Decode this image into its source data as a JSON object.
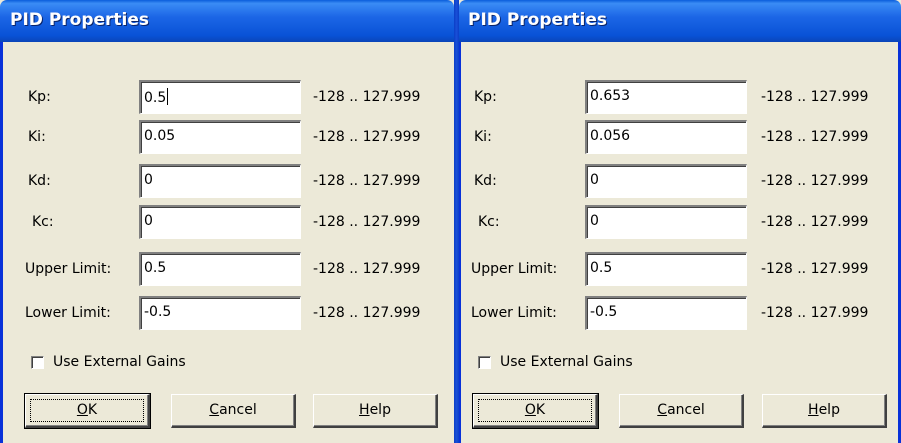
{
  "dialogs": [
    {
      "title": "PID Properties",
      "fields": [
        {
          "label": "Kp:",
          "value": "0.5",
          "range": "-128 .. 127.999"
        },
        {
          "label": "Ki:",
          "value": "0.05",
          "range": "-128 .. 127.999"
        },
        {
          "label": "Kd:",
          "value": "0",
          "range": "-128 .. 127.999"
        },
        {
          "label": "Kc:",
          "value": "0",
          "range": "-128 .. 127.999"
        },
        {
          "label": "Upper Limit:",
          "value": "0.5",
          "range": "-128 .. 127.999"
        },
        {
          "label": "Lower Limit:",
          "value": "-0.5",
          "range": "-128 .. 127.999"
        }
      ],
      "checkbox": {
        "label": "Use External Gains",
        "checked": false
      },
      "buttons": {
        "ok": {
          "mnemonic": "O",
          "rest": "K"
        },
        "cancel": {
          "mnemonic": "C",
          "rest": "ancel"
        },
        "help": {
          "mnemonic": "H",
          "rest": "elp"
        }
      }
    },
    {
      "title": "PID Properties",
      "fields": [
        {
          "label": "Kp:",
          "value": "0.653",
          "range": "-128 .. 127.999"
        },
        {
          "label": "Ki:",
          "value": "0.056",
          "range": "-128 .. 127.999"
        },
        {
          "label": "Kd:",
          "value": "0",
          "range": "-128 .. 127.999"
        },
        {
          "label": "Kc:",
          "value": "0",
          "range": "-128 .. 127.999"
        },
        {
          "label": "Upper Limit:",
          "value": "0.5",
          "range": "-128 .. 127.999"
        },
        {
          "label": "Lower Limit:",
          "value": "-0.5",
          "range": "-128 .. 127.999"
        }
      ],
      "checkbox": {
        "label": "Use External Gains",
        "checked": false
      },
      "buttons": {
        "ok": {
          "mnemonic": "O",
          "rest": "K"
        },
        "cancel": {
          "mnemonic": "C",
          "rest": "ancel"
        },
        "help": {
          "mnemonic": "H",
          "rest": "elp"
        }
      }
    }
  ],
  "colors": {
    "titlebar": "#0a5ddb",
    "dialog_bg": "#ece9d8",
    "title_text": "#ffffff"
  }
}
